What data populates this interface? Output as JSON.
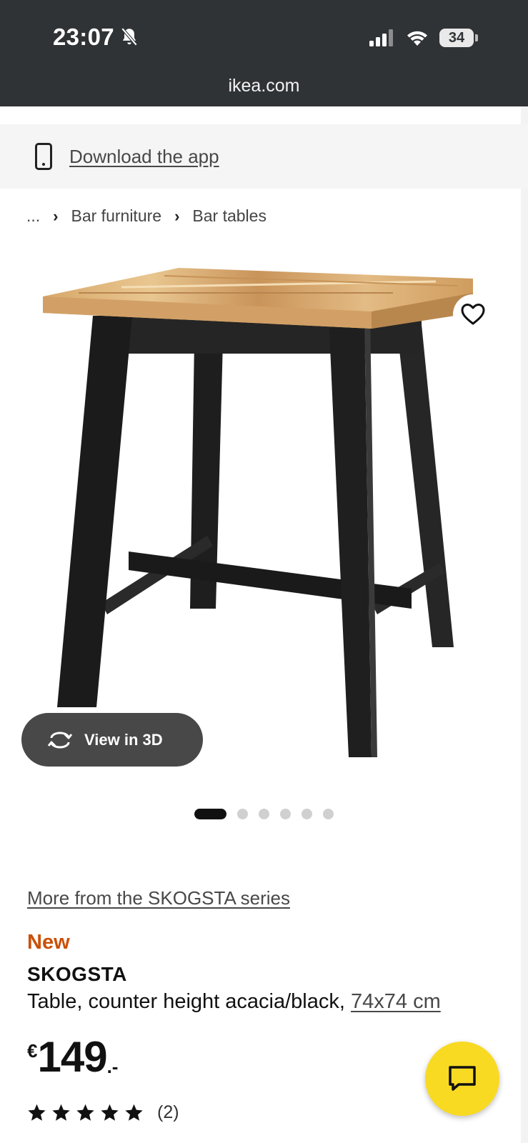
{
  "status_bar": {
    "time": "23:07",
    "battery": "34"
  },
  "browser": {
    "url": "ikea.com"
  },
  "app_banner": {
    "link": "Download the app"
  },
  "breadcrumb": {
    "items": [
      "...",
      "Bar furniture",
      "Bar tables"
    ]
  },
  "gallery": {
    "view3d_label": "View in 3D",
    "image_count": 6,
    "active_index": 0
  },
  "product": {
    "series_link": "More from the SKOGSTA series",
    "badge": "New",
    "name": "SKOGSTA",
    "description": "Table, counter height acacia/black,",
    "size": "74x74 cm",
    "currency": "€",
    "price": "149",
    "price_suffix": ".-",
    "rating": 5,
    "rating_count": "(2)"
  },
  "colors": {
    "browser_bar": "#303336",
    "new_badge": "#ca5008",
    "chat_button": "#f9da23",
    "view3d_button": "#484848"
  },
  "icons": {
    "notifications": "bell-slash-icon",
    "signal": "cellular-signal-icon",
    "wifi": "wifi-icon",
    "app": "mobile-phone-icon",
    "wishlist": "heart-icon",
    "view3d": "rotate-3d-icon",
    "rating": "star-icon",
    "chat": "chat-bubble-icon"
  }
}
